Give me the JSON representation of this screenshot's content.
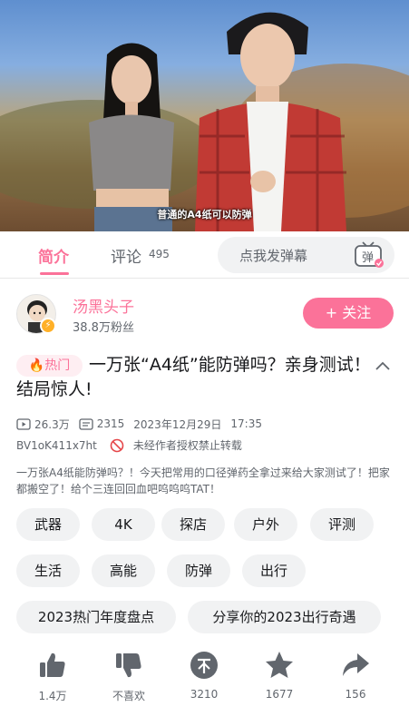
{
  "video": {
    "subtitle": "普通的A4纸可以防弹"
  },
  "tabs": {
    "intro": "简介",
    "comment": "评论",
    "comment_count": "495",
    "danmaku_placeholder": "点我发弹幕",
    "danmaku_toggle": "弹"
  },
  "uploader": {
    "name": "汤黑头子",
    "fans": "38.8万粉丝",
    "follow": "+ 关注"
  },
  "title": {
    "badge": "🔥热门",
    "text": "一万张“A4纸”能防弹吗？亲身测试！结局惊人!"
  },
  "meta": {
    "views": "26.3万",
    "danmaku": "2315",
    "date": "2023年12月29日",
    "time": "17:35",
    "bvid": "BV1oK411x7ht",
    "copyright": "未经作者授权禁止转载"
  },
  "description": "一万张A4纸能防弹吗？！今天把常用的口径弹药全拿过来给大家测试了！把家都搬空了！给个三连回回血吧呜呜呜TAT！",
  "tags": [
    "武器",
    "4K",
    "探店",
    "户外",
    "评测",
    "生活",
    "高能",
    "防弹",
    "出行",
    "2023热门年度盘点",
    "分享你的2023出行奇遇"
  ],
  "actions": {
    "like": "1.4万",
    "dislike": "不喜欢",
    "coin": "3210",
    "favorite": "1677",
    "share": "156"
  },
  "colors": {
    "accent": "#fb7299",
    "text": "#18191c",
    "secondary": "#61666d",
    "chip_bg": "#f1f2f3",
    "icon": "#61666d"
  }
}
